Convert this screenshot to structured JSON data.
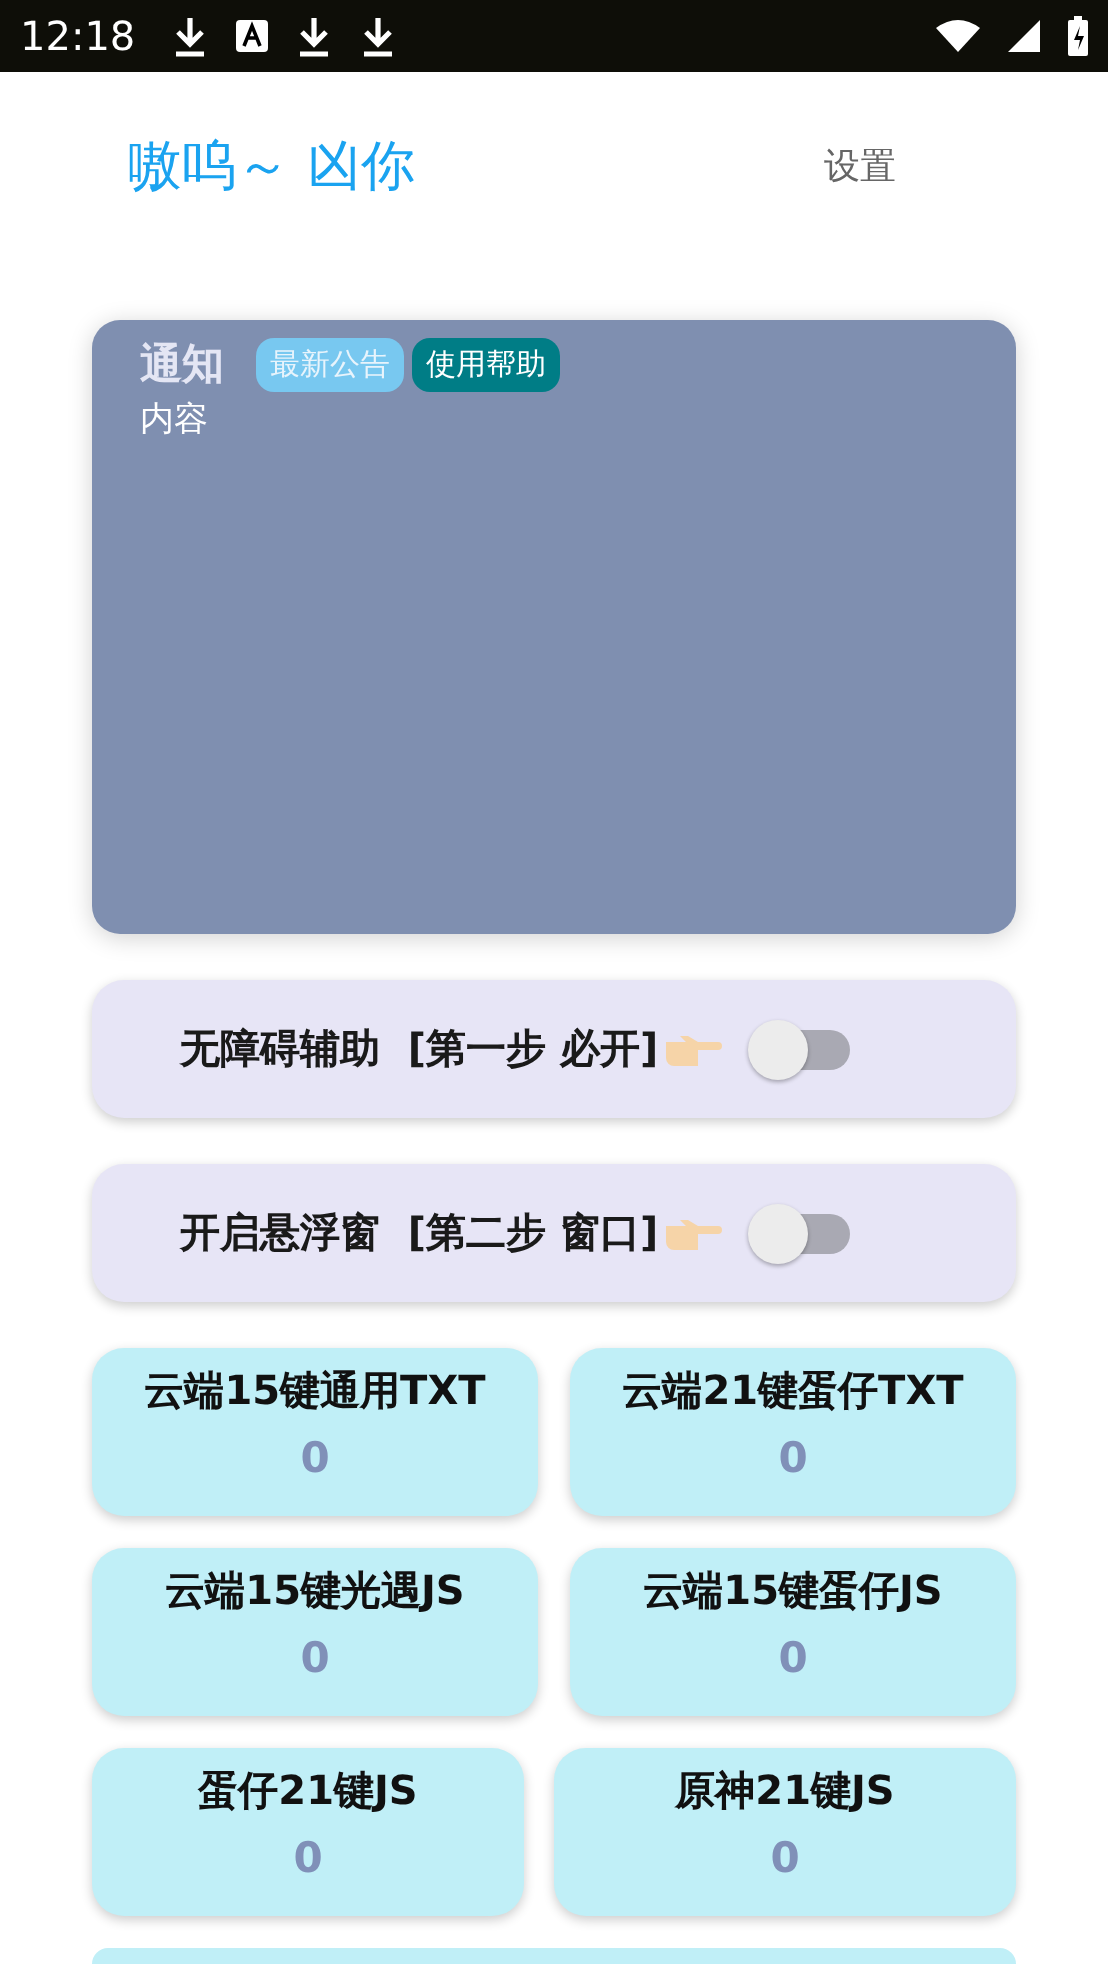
{
  "status_bar": {
    "time": "12:18"
  },
  "header": {
    "title": "嗷呜～ 凶你",
    "settings": "设置"
  },
  "notice": {
    "title": "通知",
    "tags": [
      {
        "label": "最新公告",
        "kind": "light"
      },
      {
        "label": "使用帮助",
        "kind": "dark"
      }
    ],
    "content": "内容"
  },
  "toggles": [
    {
      "label": "无障碍辅助  [第一步 必开]",
      "on": false
    },
    {
      "label": "开启悬浮窗  [第二步 窗口]",
      "on": false
    }
  ],
  "tiles": [
    [
      {
        "title": "云端15键通用TXT",
        "count": "0"
      },
      {
        "title": "云端21键蛋仔TXT",
        "count": "0"
      }
    ],
    [
      {
        "title": "云端15键光遇JS",
        "count": "0"
      },
      {
        "title": "云端15键蛋仔JS",
        "count": "0"
      }
    ],
    [
      {
        "title": "蛋仔21键JS",
        "count": "0"
      },
      {
        "title": "原神21键JS",
        "count": "0"
      }
    ]
  ]
}
